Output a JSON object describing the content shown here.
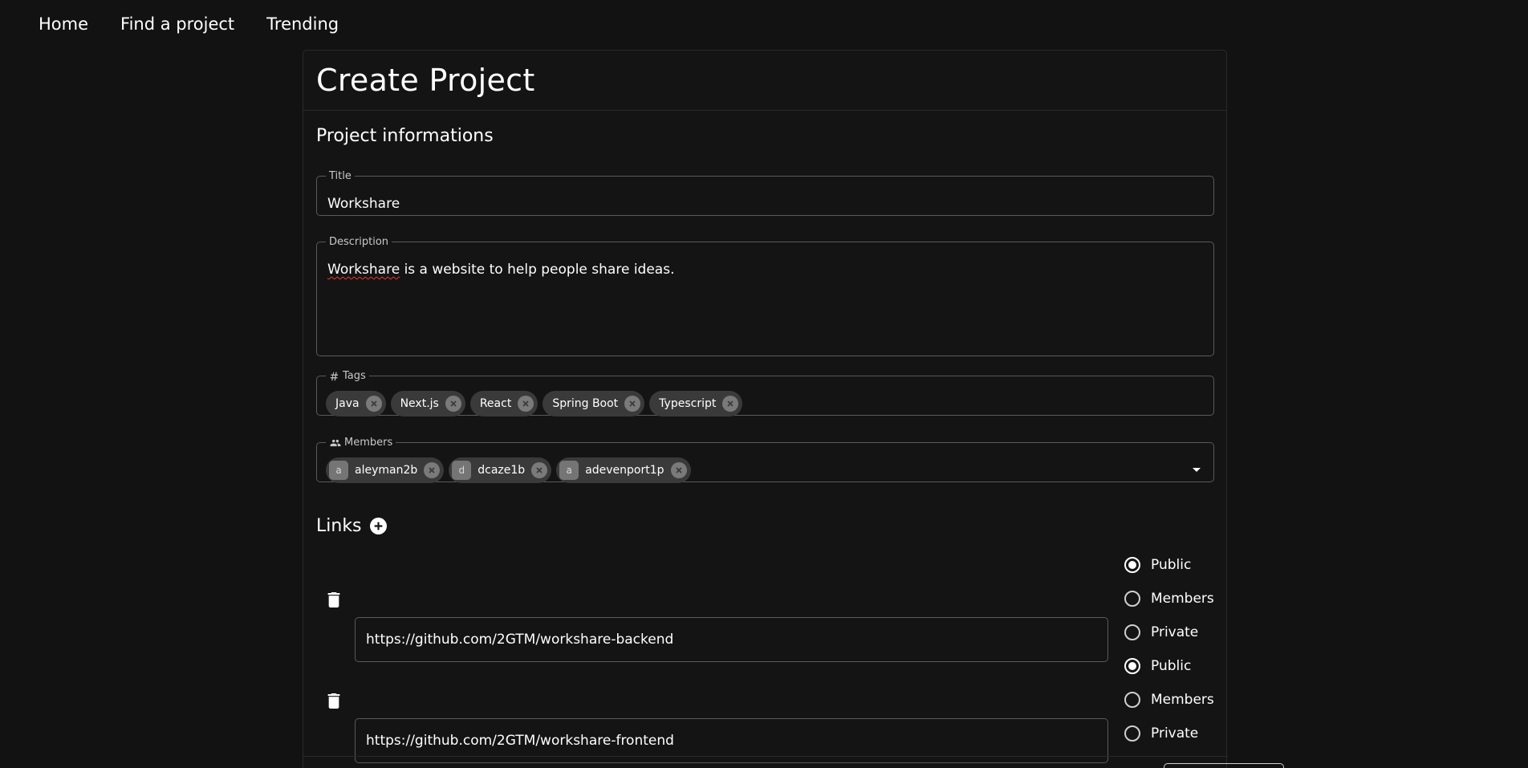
{
  "nav": {
    "items": [
      "Home",
      "Find a project",
      "Trending"
    ]
  },
  "page": {
    "title": "Create Project",
    "section_title": "Project informations"
  },
  "form": {
    "title": {
      "label": "Title",
      "value": "Workshare"
    },
    "description": {
      "label": "Description",
      "value_word1": "Workshare",
      "value_rest": " is a website to help people share ideas."
    },
    "tags": {
      "label": "Tags",
      "items": [
        "Java",
        "Next.js",
        "React",
        "Spring Boot",
        "Typescript"
      ]
    },
    "members": {
      "label": "Members",
      "items": [
        {
          "initial": "a",
          "name": "aleyman2b"
        },
        {
          "initial": "d",
          "name": "dcaze1b"
        },
        {
          "initial": "a",
          "name": "adevenport1p"
        }
      ]
    }
  },
  "links": {
    "title": "Links",
    "rows": [
      {
        "url": "https://github.com/2GTM/workshare-backend",
        "visibility": "Public"
      },
      {
        "url": "https://github.com/2GTM/workshare-frontend",
        "visibility": "Public"
      }
    ],
    "visibility_options": [
      "Public",
      "Members",
      "Private"
    ]
  },
  "colors": {
    "background": "#121212",
    "chip": "#3a3a3a",
    "border": "#5a5a5a"
  }
}
